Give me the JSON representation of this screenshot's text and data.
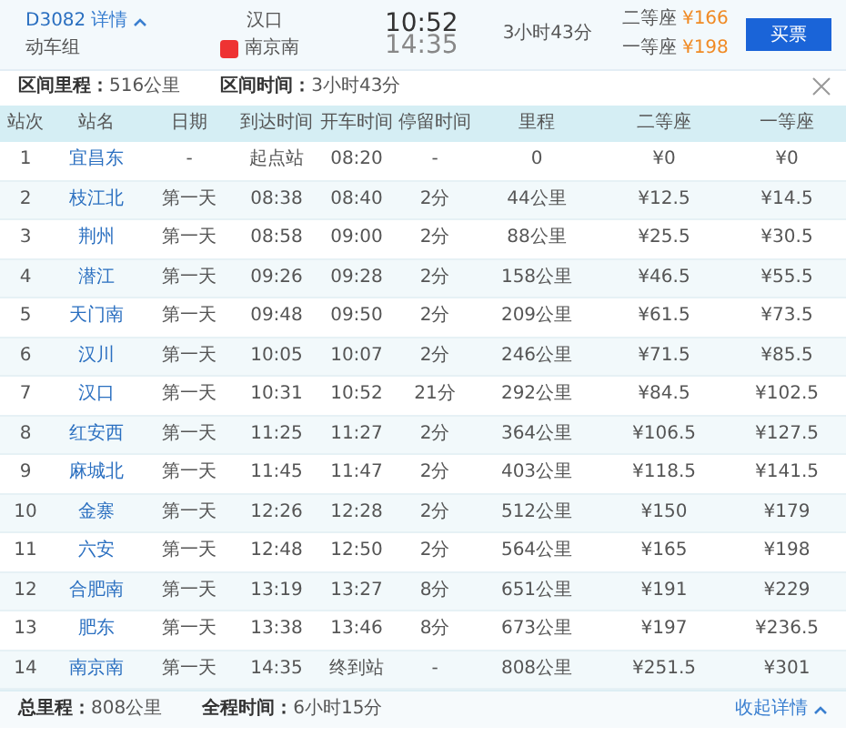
{
  "train": {
    "number": "D3082",
    "details_link": "详情",
    "type": "动车组",
    "from": "汉口",
    "to": "南京南",
    "depart": "10:52",
    "arrive": "14:35",
    "duration": "3小时43分",
    "prices": [
      {
        "seat": "二等座",
        "price": "¥166"
      },
      {
        "seat": "一等座",
        "price": "¥198"
      }
    ],
    "buy_button": "买票"
  },
  "summary": [
    {
      "label": "区间里程：",
      "value": "516公里"
    },
    {
      "label": "区间时间：",
      "value": "3小时43分"
    }
  ],
  "table": {
    "columns": [
      "站次",
      "站名",
      "日期",
      "到达时间",
      "开车时间",
      "停留时间",
      "里程",
      "二等座",
      "一等座"
    ],
    "rows": [
      [
        "1",
        "宜昌东",
        "-",
        "起点站",
        "08:20",
        "-",
        "0",
        "¥0",
        "¥0"
      ],
      [
        "2",
        "枝江北",
        "第一天",
        "08:38",
        "08:40",
        "2分",
        "44公里",
        "¥12.5",
        "¥14.5"
      ],
      [
        "3",
        "荆州",
        "第一天",
        "08:58",
        "09:00",
        "2分",
        "88公里",
        "¥25.5",
        "¥30.5"
      ],
      [
        "4",
        "潜江",
        "第一天",
        "09:26",
        "09:28",
        "2分",
        "158公里",
        "¥46.5",
        "¥55.5"
      ],
      [
        "5",
        "天门南",
        "第一天",
        "09:48",
        "09:50",
        "2分",
        "209公里",
        "¥61.5",
        "¥73.5"
      ],
      [
        "6",
        "汉川",
        "第一天",
        "10:05",
        "10:07",
        "2分",
        "246公里",
        "¥71.5",
        "¥85.5"
      ],
      [
        "7",
        "汉口",
        "第一天",
        "10:31",
        "10:52",
        "21分",
        "292公里",
        "¥84.5",
        "¥102.5"
      ],
      [
        "8",
        "红安西",
        "第一天",
        "11:25",
        "11:27",
        "2分",
        "364公里",
        "¥106.5",
        "¥127.5"
      ],
      [
        "9",
        "麻城北",
        "第一天",
        "11:45",
        "11:47",
        "2分",
        "403公里",
        "¥118.5",
        "¥141.5"
      ],
      [
        "10",
        "金寨",
        "第一天",
        "12:26",
        "12:28",
        "2分",
        "512公里",
        "¥150",
        "¥179"
      ],
      [
        "11",
        "六安",
        "第一天",
        "12:48",
        "12:50",
        "2分",
        "564公里",
        "¥165",
        "¥198"
      ],
      [
        "12",
        "合肥南",
        "第一天",
        "13:19",
        "13:27",
        "8分",
        "651公里",
        "¥191",
        "¥229"
      ],
      [
        "13",
        "肥东",
        "第一天",
        "13:38",
        "13:46",
        "8分",
        "673公里",
        "¥197",
        "¥236.5"
      ],
      [
        "14",
        "南京南",
        "第一天",
        "14:35",
        "终到站",
        "-",
        "808公里",
        "¥251.5",
        "¥301"
      ]
    ]
  },
  "footer": {
    "items": [
      {
        "label": "总里程：",
        "value": "808公里"
      },
      {
        "label": "全程时间：",
        "value": "6小时15分"
      }
    ],
    "collapse_link": "收起详情"
  }
}
